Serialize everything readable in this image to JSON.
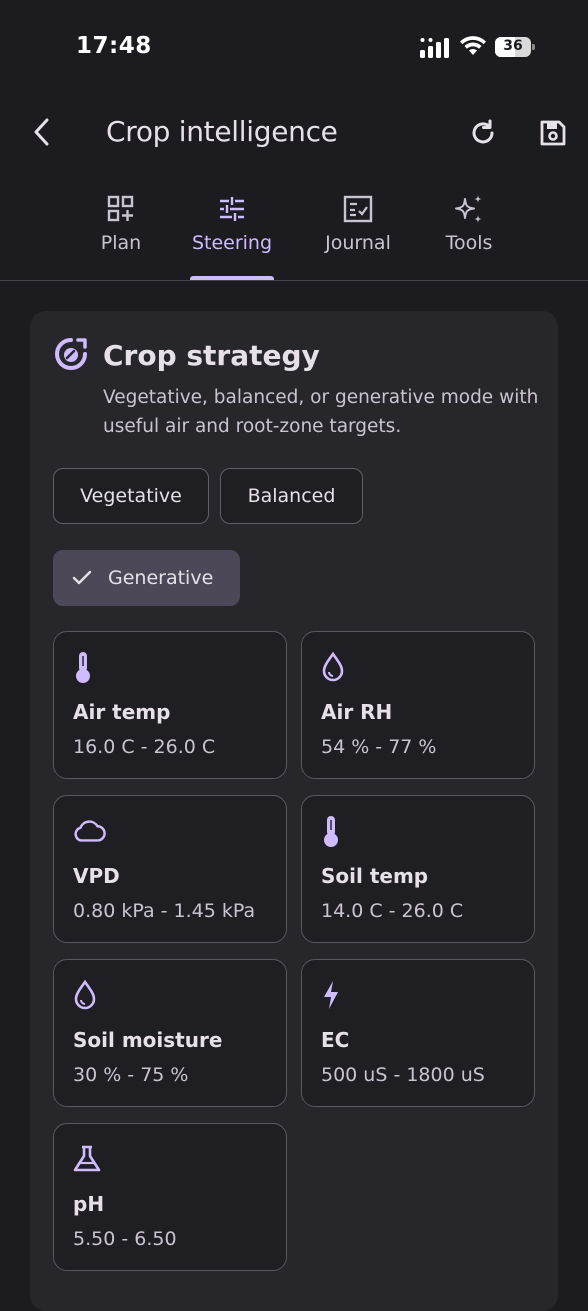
{
  "status_bar": {
    "time": "17:48",
    "battery": "36"
  },
  "app_bar": {
    "title": "Crop intelligence",
    "back_icon": "chevron-left-icon",
    "refresh_icon": "refresh-icon",
    "save_icon": "save-icon"
  },
  "tabs": [
    {
      "label": "Plan",
      "icon": "grid-plus-icon",
      "active": false
    },
    {
      "label": "Steering",
      "icon": "sliders-icon",
      "active": true
    },
    {
      "label": "Journal",
      "icon": "journal-check-icon",
      "active": false
    },
    {
      "label": "Tools",
      "icon": "sparkles-icon",
      "active": false
    }
  ],
  "strategy": {
    "title": "Crop strategy",
    "description": "Vegetative, balanced, or generative mode with useful air and root-zone targets.",
    "modes": [
      {
        "label": "Vegetative",
        "selected": false
      },
      {
        "label": "Balanced",
        "selected": false
      },
      {
        "label": "Generative",
        "selected": true
      }
    ],
    "metrics": [
      {
        "title": "Air temp",
        "value": "16.0 C - 26.0 C",
        "icon": "thermometer-icon"
      },
      {
        "title": "Air RH",
        "value": "54 % - 77 %",
        "icon": "droplet-icon"
      },
      {
        "title": "VPD",
        "value": "0.80 kPa - 1.45 kPa",
        "icon": "cloud-icon"
      },
      {
        "title": "Soil temp",
        "value": "14.0 C - 26.0 C",
        "icon": "thermometer-icon"
      },
      {
        "title": "Soil moisture",
        "value": "30 % - 75 %",
        "icon": "droplet-icon"
      },
      {
        "title": "EC",
        "value": "500 uS - 1800 uS",
        "icon": "bolt-icon"
      },
      {
        "title": "pH",
        "value": "5.50 - 6.50",
        "icon": "flask-icon"
      }
    ]
  },
  "colors": {
    "background": "#1c1b20",
    "accent": "#cfbcff",
    "card": "#27262b",
    "selected_chip": "#4d4858"
  }
}
